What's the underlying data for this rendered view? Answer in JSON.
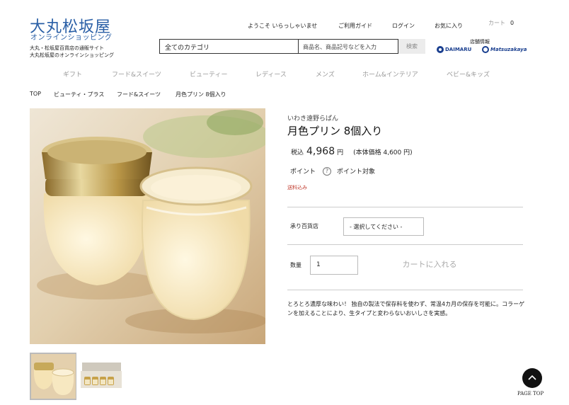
{
  "header": {
    "logo_title": "大丸松坂屋",
    "logo_sub": "オンラインショッピング",
    "logo_desc_1": "大丸・松坂屋百貨店の通販サイト",
    "logo_desc_2": "大丸松坂屋のオンラインショッピング",
    "welcome": "ようこそ いらっしゃいませ",
    "guide": "ご利用ガイド",
    "login": "ログイン",
    "favorites": "お気に入り",
    "cart_label": "カート",
    "cart_count": "0",
    "store_info": "店舗情報",
    "daimaru": "DAIMARU",
    "matsuzakaya": "Matsuzakaya"
  },
  "search": {
    "category": "全てのカテゴリ",
    "placeholder": "商品名、商品記号などを入力",
    "button": "検索"
  },
  "category_nav": [
    "ギフト",
    "フード&スイーツ",
    "ビューティー",
    "レディース",
    "メンズ",
    "ホーム&インテリア",
    "ベビー&キッズ"
  ],
  "breadcrumb": [
    "TOP",
    "ビューティ・プラス",
    "フード&スイーツ",
    "月色プリン 8個入り"
  ],
  "product": {
    "brand": "いわき遠野らぱん",
    "title": "月色プリン 8個入り",
    "price_prefix": "税込",
    "price": "4,968",
    "price_unit": "円",
    "price_base": "(本体価格 4,600 円)",
    "points_label": "ポイント",
    "points_value": "ポイント対象",
    "shipping": "送料込み",
    "store_label": "承り百貨店",
    "store_select": "- 選択してください -",
    "qty_label": "数量",
    "qty_value": "1",
    "add_to_cart": "カートに入れる",
    "description": "とろとろ濃厚な味わい！ 独自の製法で保存料を使わず、常温4カ月の保存を可能に。コラーゲンを加えることにより、生タイプと変わらないおいしさを実感。"
  },
  "page_top": "PAGE TOP",
  "colors": {
    "brand_blue": "#2a5fa6",
    "shipping_red": "#c0392b",
    "muted": "#999999"
  }
}
